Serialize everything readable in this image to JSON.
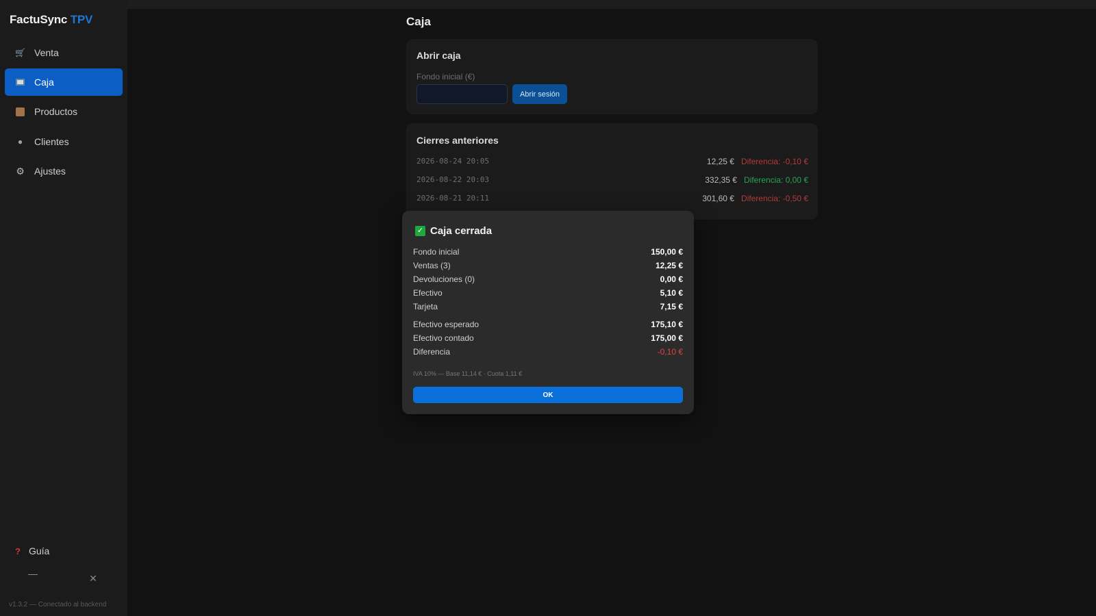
{
  "app": {
    "brand_main": "FactuSync",
    "brand_accent": "TPV",
    "accent_color": "#1f78d1"
  },
  "sidebar": {
    "items": [
      {
        "label": "Venta",
        "icon": "cart-icon",
        "active": false
      },
      {
        "label": "Caja",
        "icon": "cash-register-icon",
        "active": true
      },
      {
        "label": "Productos",
        "icon": "box-icon",
        "active": false
      },
      {
        "label": "Clientes",
        "icon": "people-icon",
        "active": false
      },
      {
        "label": "Ajustes",
        "icon": "gear-icon",
        "active": false
      }
    ],
    "guide_label": "Guía",
    "guide_icon": "question-icon",
    "status_text": "v1.3.2 — Conectado al backend"
  },
  "main": {
    "title": "Caja",
    "open_card": {
      "title": "Abrir caja",
      "field_label": "Fondo inicial (€)",
      "field_value": "",
      "button_label": "Abrir sesión"
    },
    "history_card": {
      "title": "Cierres anteriores",
      "rows": [
        {
          "date": "2026-08-24 20:05",
          "amount": "12,25 €",
          "difference": "Diferencia: -0,10 €",
          "difference_status": "negative"
        },
        {
          "date": "2026-08-22 20:03",
          "amount": "332,35 €",
          "difference": "Diferencia: 0,00 €",
          "difference_status": "positive"
        },
        {
          "date": "2026-08-21 20:11",
          "amount": "301,60 €",
          "difference": "Diferencia: -0,50 €",
          "difference_status": "negative"
        }
      ]
    }
  },
  "modal": {
    "title": "Caja cerrada",
    "icon": "check-icon",
    "rows": [
      {
        "label": "Fondo inicial",
        "value": "150,00 €"
      },
      {
        "label": "Ventas (3)",
        "value": "12,25 €"
      },
      {
        "label": "Devoluciones (0)",
        "value": "0,00 €"
      },
      {
        "label": "Efectivo",
        "value": "5,10 €"
      },
      {
        "label": "Tarjeta",
        "value": "7,15 €"
      },
      {
        "label": "Efectivo esperado",
        "value": "175,10 €"
      },
      {
        "label": "Efectivo contado",
        "value": "175,00 €"
      },
      {
        "label": "Diferencia",
        "value": "-0,10 €"
      }
    ],
    "tax_note": "IVA 10% — Base 11,14 € · Cuota 1,11 €",
    "ok_label": "OK"
  },
  "colors": {
    "negative": "#e04545",
    "positive": "#26a657",
    "primary": "#0a6fd8"
  }
}
